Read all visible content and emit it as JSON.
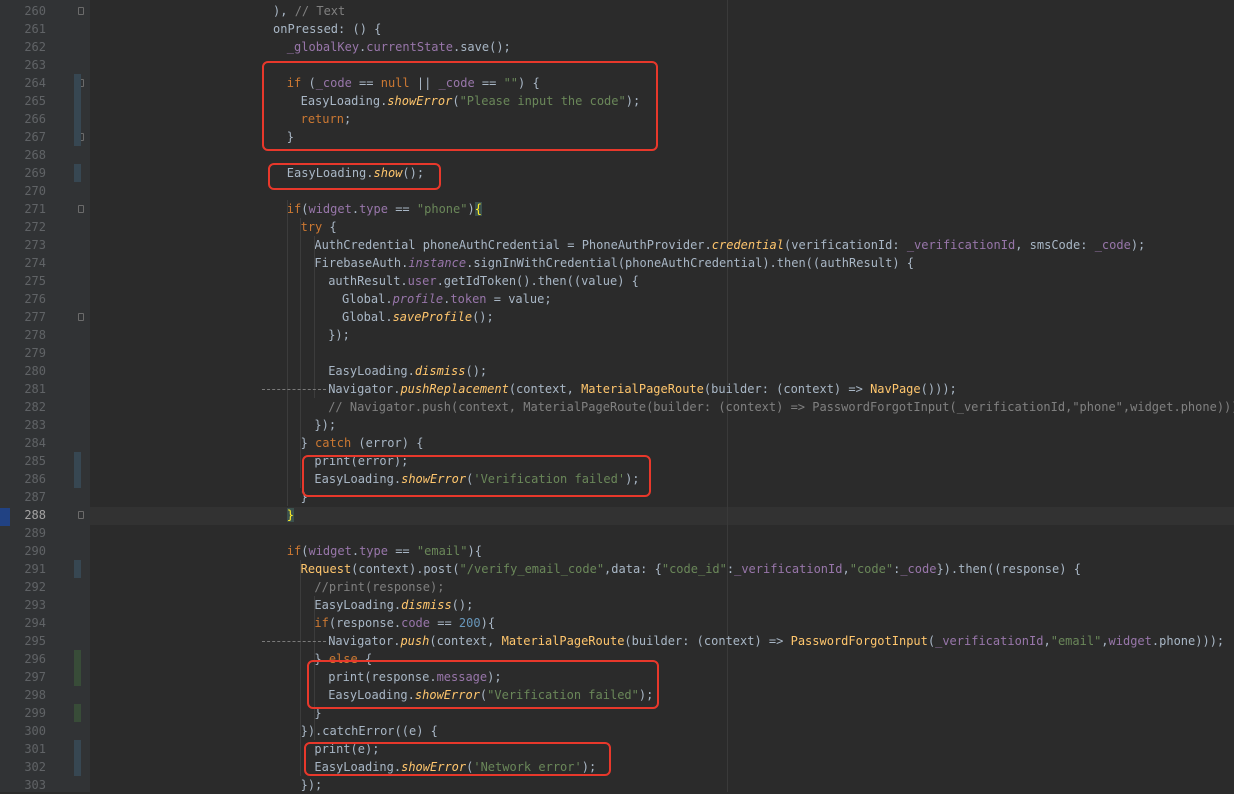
{
  "editor": {
    "lines": [
      {
        "n": "260",
        "indent": 30,
        "tokens": [
          [
            "p",
            "), "
          ],
          [
            "cm",
            "// Text"
          ]
        ]
      },
      {
        "n": "261",
        "indent": 30,
        "tokens": [
          [
            "p",
            "onPressed: () {"
          ]
        ]
      },
      {
        "n": "262",
        "indent": 32,
        "tokens": [
          [
            "fld",
            "_globalKey"
          ],
          [
            "p",
            "."
          ],
          [
            "fld",
            "currentState"
          ],
          [
            "p",
            ".save();"
          ]
        ]
      },
      {
        "n": "263",
        "indent": 0,
        "tokens": []
      },
      {
        "n": "264",
        "indent": 32,
        "tokens": [
          [
            "kw",
            "if"
          ],
          [
            "p",
            " ("
          ],
          [
            "fld",
            "_code"
          ],
          [
            "p",
            " == "
          ],
          [
            "kw",
            "null"
          ],
          [
            "p",
            " || "
          ],
          [
            "fld",
            "_code"
          ],
          [
            "p",
            " == "
          ],
          [
            "str",
            "\"\""
          ],
          [
            "p",
            ") {"
          ]
        ]
      },
      {
        "n": "265",
        "indent": 34,
        "tokens": [
          [
            "p",
            "EasyLoading."
          ],
          [
            "ifn",
            "showError"
          ],
          [
            "p",
            "("
          ],
          [
            "str",
            "\"Please input the code\""
          ],
          [
            "p",
            ");"
          ]
        ]
      },
      {
        "n": "266",
        "indent": 34,
        "tokens": [
          [
            "kw",
            "return"
          ],
          [
            "p",
            ";"
          ]
        ]
      },
      {
        "n": "267",
        "indent": 32,
        "tokens": [
          [
            "p",
            "}"
          ]
        ]
      },
      {
        "n": "268",
        "indent": 0,
        "tokens": []
      },
      {
        "n": "269",
        "indent": 32,
        "tokens": [
          [
            "p",
            "EasyLoading."
          ],
          [
            "ifn",
            "show"
          ],
          [
            "p",
            "();"
          ]
        ]
      },
      {
        "n": "270",
        "indent": 0,
        "tokens": []
      },
      {
        "n": "271",
        "indent": 32,
        "tokens": [
          [
            "kw",
            "if"
          ],
          [
            "p",
            "("
          ],
          [
            "fld",
            "widget"
          ],
          [
            "p",
            "."
          ],
          [
            "fld",
            "type"
          ],
          [
            "p",
            " == "
          ],
          [
            "str",
            "\"phone\""
          ],
          [
            "p",
            ")"
          ],
          [
            "hb",
            "{"
          ]
        ]
      },
      {
        "n": "272",
        "indent": 34,
        "tokens": [
          [
            "kw",
            "try"
          ],
          [
            "p",
            " {"
          ]
        ]
      },
      {
        "n": "273",
        "indent": 36,
        "tokens": [
          [
            "p",
            "AuthCredential phoneAuthCredential = PhoneAuthProvider."
          ],
          [
            "ifn",
            "credential"
          ],
          [
            "p",
            "(verificationId: "
          ],
          [
            "fld",
            "_verificationId"
          ],
          [
            "p",
            ", smsCode: "
          ],
          [
            "fld",
            "_code"
          ],
          [
            "p",
            ");"
          ]
        ]
      },
      {
        "n": "274",
        "indent": 36,
        "tokens": [
          [
            "p",
            "FirebaseAuth."
          ],
          [
            "ifld",
            "instance"
          ],
          [
            "p",
            ".signInWithCredential(phoneAuthCredential).then((authResult) {"
          ]
        ]
      },
      {
        "n": "275",
        "indent": 38,
        "tokens": [
          [
            "p",
            "authResult."
          ],
          [
            "fld",
            "user"
          ],
          [
            "p",
            ".getIdToken().then((value) {"
          ]
        ]
      },
      {
        "n": "276",
        "indent": 40,
        "tokens": [
          [
            "p",
            "Global."
          ],
          [
            "ifld",
            "profile"
          ],
          [
            "p",
            "."
          ],
          [
            "fld",
            "token"
          ],
          [
            "p",
            " = value;"
          ]
        ]
      },
      {
        "n": "277",
        "indent": 40,
        "tokens": [
          [
            "p",
            "Global."
          ],
          [
            "ifn",
            "saveProfile"
          ],
          [
            "p",
            "();"
          ]
        ]
      },
      {
        "n": "278",
        "indent": 38,
        "tokens": [
          [
            "p",
            "});"
          ]
        ]
      },
      {
        "n": "279",
        "indent": 0,
        "tokens": []
      },
      {
        "n": "280",
        "indent": 38,
        "tokens": [
          [
            "p",
            "EasyLoading."
          ],
          [
            "ifn",
            "dismiss"
          ],
          [
            "p",
            "();"
          ]
        ]
      },
      {
        "n": "281",
        "indent": 38,
        "tokens": [
          [
            "p",
            "Navigator."
          ],
          [
            "ifn",
            "pushReplacement"
          ],
          [
            "p",
            "(context, "
          ],
          [
            "fn",
            "MaterialPageRoute"
          ],
          [
            "p",
            "(builder: (context) => "
          ],
          [
            "fn",
            "NavPage"
          ],
          [
            "p",
            "()));"
          ]
        ]
      },
      {
        "n": "282",
        "indent": 38,
        "tokens": [
          [
            "cm",
            "// Navigator.push(context, MaterialPageRoute(builder: (context) => PasswordForgotInput(_verificationId,\"phone\",widget.phone)));"
          ]
        ]
      },
      {
        "n": "283",
        "indent": 36,
        "tokens": [
          [
            "p",
            "});"
          ]
        ]
      },
      {
        "n": "284",
        "indent": 34,
        "tokens": [
          [
            "p",
            "} "
          ],
          [
            "kw",
            "catch"
          ],
          [
            "p",
            " (error) {"
          ]
        ]
      },
      {
        "n": "285",
        "indent": 36,
        "tokens": [
          [
            "p",
            "print(error);"
          ]
        ]
      },
      {
        "n": "286",
        "indent": 36,
        "tokens": [
          [
            "p",
            "EasyLoading."
          ],
          [
            "ifn",
            "showError"
          ],
          [
            "p",
            "("
          ],
          [
            "str",
            "'Verification failed'"
          ],
          [
            "p",
            ");"
          ]
        ]
      },
      {
        "n": "287",
        "indent": 34,
        "tokens": [
          [
            "p",
            "}"
          ]
        ]
      },
      {
        "n": "288",
        "indent": 32,
        "tokens": [
          [
            "hb",
            "}"
          ]
        ]
      },
      {
        "n": "289",
        "indent": 0,
        "tokens": []
      },
      {
        "n": "290",
        "indent": 32,
        "tokens": [
          [
            "kw",
            "if"
          ],
          [
            "p",
            "("
          ],
          [
            "fld",
            "widget"
          ],
          [
            "p",
            "."
          ],
          [
            "fld",
            "type"
          ],
          [
            "p",
            " == "
          ],
          [
            "str",
            "\"email\""
          ],
          [
            "p",
            "){"
          ]
        ]
      },
      {
        "n": "291",
        "indent": 34,
        "tokens": [
          [
            "fn",
            "Request"
          ],
          [
            "p",
            "(context).post("
          ],
          [
            "str",
            "\"/verify_email_code\""
          ],
          [
            "p",
            ",data: {"
          ],
          [
            "str",
            "\"code_id\""
          ],
          [
            "p",
            ":"
          ],
          [
            "fld",
            "_verificationId"
          ],
          [
            "p",
            ","
          ],
          [
            "str",
            "\"code\""
          ],
          [
            "p",
            ":"
          ],
          [
            "fld",
            "_code"
          ],
          [
            "p",
            "}).then((response) {"
          ]
        ]
      },
      {
        "n": "292",
        "indent": 36,
        "tokens": [
          [
            "cm",
            "//print(response);"
          ]
        ]
      },
      {
        "n": "293",
        "indent": 36,
        "tokens": [
          [
            "p",
            "EasyLoading."
          ],
          [
            "ifn",
            "dismiss"
          ],
          [
            "p",
            "();"
          ]
        ]
      },
      {
        "n": "294",
        "indent": 36,
        "tokens": [
          [
            "kw",
            "if"
          ],
          [
            "p",
            "(response."
          ],
          [
            "fld",
            "code"
          ],
          [
            "p",
            " == "
          ],
          [
            "num",
            "200"
          ],
          [
            "p",
            "){"
          ]
        ]
      },
      {
        "n": "295",
        "indent": 38,
        "tokens": [
          [
            "p",
            "Navigator."
          ],
          [
            "ifn",
            "push"
          ],
          [
            "p",
            "(context, "
          ],
          [
            "fn",
            "MaterialPageRoute"
          ],
          [
            "p",
            "(builder: (context) => "
          ],
          [
            "fn",
            "PasswordForgotInput"
          ],
          [
            "p",
            "("
          ],
          [
            "fld",
            "_verificationId"
          ],
          [
            "p",
            ","
          ],
          [
            "str",
            "\"email\""
          ],
          [
            "p",
            ","
          ],
          [
            "fld",
            "widget"
          ],
          [
            "p",
            ".phone)));"
          ]
        ]
      },
      {
        "n": "296",
        "indent": 36,
        "tokens": [
          [
            "p",
            "} "
          ],
          [
            "kw",
            "else"
          ],
          [
            "p",
            " {"
          ]
        ]
      },
      {
        "n": "297",
        "indent": 38,
        "tokens": [
          [
            "p",
            "print(response."
          ],
          [
            "fld",
            "message"
          ],
          [
            "p",
            ");"
          ]
        ]
      },
      {
        "n": "298",
        "indent": 38,
        "tokens": [
          [
            "p",
            "EasyLoading."
          ],
          [
            "ifn",
            "showError"
          ],
          [
            "p",
            "("
          ],
          [
            "str",
            "\"Verification failed\""
          ],
          [
            "p",
            ");"
          ]
        ]
      },
      {
        "n": "299",
        "indent": 36,
        "tokens": [
          [
            "p",
            "}"
          ]
        ]
      },
      {
        "n": "300",
        "indent": 34,
        "tokens": [
          [
            "p",
            "}).catchError((e) {"
          ]
        ]
      },
      {
        "n": "301",
        "indent": 36,
        "tokens": [
          [
            "p",
            "print(e);"
          ]
        ]
      },
      {
        "n": "302",
        "indent": 36,
        "tokens": [
          [
            "p",
            "EasyLoading."
          ],
          [
            "ifn",
            "showError"
          ],
          [
            "p",
            "("
          ],
          [
            "str",
            "'Network error'"
          ],
          [
            "p",
            ");"
          ]
        ]
      },
      {
        "n": "303",
        "indent": 34,
        "tokens": [
          [
            "p",
            "});"
          ]
        ]
      }
    ],
    "current_line": "288",
    "colors": {
      "background": "#2b2b2b",
      "gutter": "#313335",
      "highlight_box": "#e8382b",
      "keyword": "#cc7832",
      "string": "#6a8759",
      "field": "#9876aa",
      "comment": "#808080",
      "function": "#ffc66d",
      "number": "#6897bb",
      "text": "#a9b7c6"
    }
  }
}
